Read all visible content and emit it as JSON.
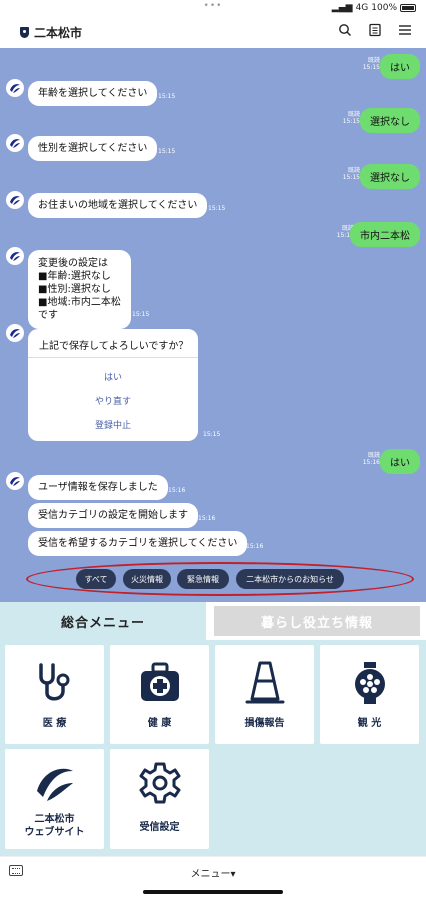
{
  "status_bar": {
    "dots": "•••",
    "signal": "4G",
    "battery": "100%"
  },
  "header": {
    "title": "二本松市"
  },
  "chat": {
    "messages": [
      {
        "side": "out",
        "text": "はい",
        "read": "既読",
        "time": "15:15"
      },
      {
        "side": "in",
        "text": "年齢を選択してください",
        "time": "15:15"
      },
      {
        "side": "out",
        "text": "選択なし",
        "read": "既読",
        "time": "15:15"
      },
      {
        "side": "in",
        "text": "性別を選択してください",
        "time": "15:15"
      },
      {
        "side": "out",
        "text": "選択なし",
        "read": "既読",
        "time": "15:15"
      },
      {
        "side": "in",
        "text": "お住まいの地域を選択してください",
        "time": "15:15"
      },
      {
        "side": "out",
        "text": "市内二本松",
        "read": "既読",
        "time": "15:15"
      },
      {
        "side": "in",
        "lines": [
          "変更後の設定は",
          "■年齢:選択なし",
          "■性別:選択なし",
          "■地域:市内二本松",
          "です"
        ],
        "time": "15:15"
      },
      {
        "side": "card",
        "title": "上記で保存してよろしいですか？",
        "options": [
          "はい",
          "やり直す",
          "登録中止"
        ],
        "time": "15:15"
      },
      {
        "side": "out",
        "text": "はい",
        "read": "既読",
        "time": "15:16"
      },
      {
        "side": "in",
        "text": "ユーザ情報を保存しました",
        "time": "15:16"
      },
      {
        "side": "in",
        "text": "受信カテゴリの設定を開始します",
        "time": "15:16"
      },
      {
        "side": "in",
        "text": "受信を希望するカテゴリを選択してください",
        "time": "15:16"
      }
    ],
    "quick_replies": [
      "すべて",
      "火災情報",
      "緊急情報",
      "二本松市からのお知らせ"
    ]
  },
  "rich_menu": {
    "tab_active": "総合メニュー",
    "tab_inactive": "暮らし役立ち情報",
    "tiles": [
      {
        "label": "医 療",
        "icon": "stethoscope-icon"
      },
      {
        "label": "健 康",
        "icon": "first-aid-kit-icon"
      },
      {
        "label": "損傷報告",
        "icon": "traffic-cone-icon"
      },
      {
        "label": "観 光",
        "icon": "lantern-icon"
      },
      {
        "label": "二本松市\nウェブサイト",
        "icon": "city-logo-icon"
      },
      {
        "label": "受信設定",
        "icon": "gear-icon"
      }
    ]
  },
  "footer": {
    "label": "メニュー▾"
  },
  "colors": {
    "chat_bg": "#8aa2d6",
    "out_bubble": "#6fdc6f",
    "chip": "#2b3856",
    "menu_bg": "#cfe9ef",
    "navy": "#1a2a4a",
    "highlight": "#c0202a"
  }
}
